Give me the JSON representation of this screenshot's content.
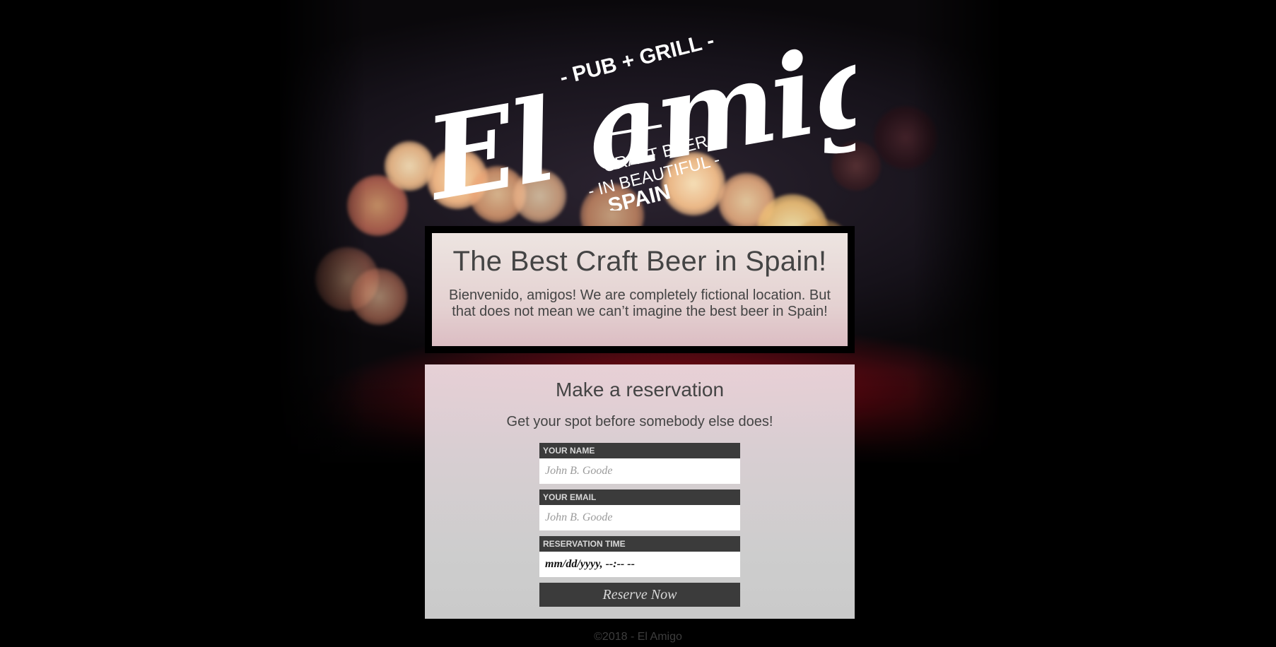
{
  "logo": {
    "name": "El amigo",
    "tagline_top": "- PUB + GRILL -",
    "tagline_line1": "CRAFT BEER",
    "tagline_line2": "- IN BEAUTIFUL -",
    "tagline_line3": "SPAIN"
  },
  "intro": {
    "title": "The Best Craft Beer in Spain!",
    "text": "Bienvenido, amigos! We are completely fictional location. But that does not mean we can’t imagine the best beer in Spain!"
  },
  "reservation": {
    "title": "Make a reservation",
    "subtitle": "Get your spot before somebody else does!",
    "fields": {
      "name": {
        "label": "YOUR NAME",
        "placeholder": "John B. Goode"
      },
      "email": {
        "label": "YOUR EMAIL",
        "placeholder": "John B. Goode"
      },
      "time": {
        "label": "RESERVATION TIME",
        "value": "mm/dd/yyyy, --:-- --"
      }
    },
    "button_label": "Reserve Now"
  },
  "footer": {
    "text": "©2018 - El Amigo"
  },
  "colors": {
    "page_background": "#000000",
    "field_label_bg": "#3b3b3b",
    "text": "#444444"
  }
}
